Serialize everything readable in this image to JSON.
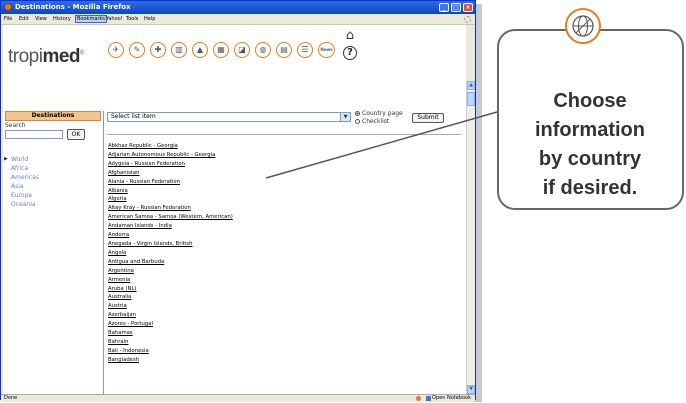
{
  "window": {
    "title": "Destinations - Mozilla Firefox",
    "controls": [
      "_",
      "□",
      "×"
    ]
  },
  "menu": [
    "File",
    "Edit",
    "View",
    "History",
    "Bookmarks",
    "Yahoo!",
    "Tools",
    "Help"
  ],
  "logo": {
    "light": "tropi",
    "bold": "med",
    "mark": "®"
  },
  "nav_icons": [
    "suitcase-icon",
    "syringe-icon",
    "medicine-icon",
    "hospital-icon",
    "mountain-icon",
    "calendar-icon",
    "map-icon",
    "globe-icon",
    "document-icon",
    "list-icon",
    "news-icon"
  ],
  "nav_news_label": "News",
  "sidebar": {
    "tab_label": "Destinations",
    "search_label": "Search",
    "search_value": "",
    "ok_label": "OK",
    "regions": [
      "World",
      "Africa",
      "Americas",
      "Asia",
      "Europe",
      "Oceania"
    ]
  },
  "main": {
    "select_value": "Select list item",
    "radio_country": "Country page",
    "radio_checklist": "Checklist",
    "submit_label": "Submit",
    "countries": [
      "Abkhaz Republic - Georgia",
      "Adjarian Autonomous Republic - Georgia",
      "Adygeia - Russian Federation",
      "Afghanistan",
      "Alania - Russian Federation",
      "Albania",
      "Algeria",
      "Altay Kray - Russian Federation",
      "American Samoa - Samoa (Western, American)",
      "Andaman Islands - India",
      "Andorra",
      "Anegada - Virgin Islands, British",
      "Angola",
      "Antigua and Barbuda",
      "Argentina",
      "Armenia",
      "Aruba (NL)",
      "Australia",
      "Austria",
      "Azerbaijan",
      "Azores - Portugal",
      "Bahamas",
      "Bahrain",
      "Bali - Indonesia",
      "Bangladesh"
    ]
  },
  "status": {
    "text": "Done",
    "notebook": "Open Notebook"
  },
  "callout": {
    "lines": [
      "Choose",
      "information",
      "by country",
      "if desired."
    ],
    "icon": "globe-icon"
  },
  "colors": {
    "accent": "#e27d1d",
    "titlebar": "#0a47c9",
    "link": "#6b7fbf"
  }
}
